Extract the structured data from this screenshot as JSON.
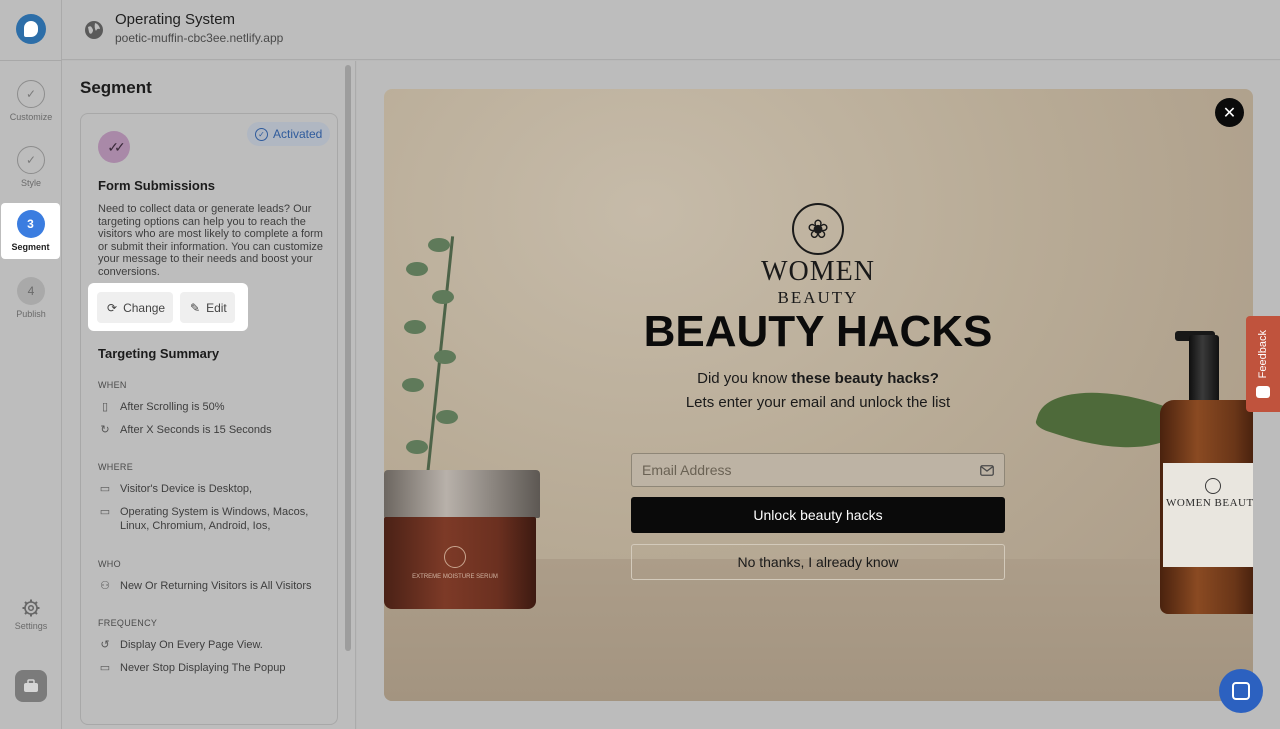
{
  "header": {
    "title": "Operating System",
    "url": "poetic-muffin-cbc3ee.netlify.app"
  },
  "rail": {
    "steps": [
      {
        "label": "Customize",
        "state": "done"
      },
      {
        "label": "Style",
        "state": "done"
      },
      {
        "number": "3",
        "label": "Segment",
        "state": "active"
      },
      {
        "number": "4",
        "label": "Publish",
        "state": "pending"
      }
    ],
    "settings_label": "Settings"
  },
  "panel": {
    "title": "Segment",
    "badge": "Activated",
    "segment_title": "Form Submissions",
    "segment_desc": "Need to collect data or generate leads? Our targeting options can help you to reach the visitors who are most likely to complete a form or submit their information. You can customize your message to their needs and boost your conversions.",
    "change_label": "Change",
    "edit_label": "Edit",
    "summary_title": "Targeting Summary",
    "sections": {
      "when": {
        "label": "WHEN",
        "rules": [
          "After Scrolling is 50%",
          "After X Seconds is 15 Seconds"
        ]
      },
      "where": {
        "label": "WHERE",
        "rules": [
          "Visitor's Device is Desktop,",
          "Operating System is Windows, Macos, Linux, Chromium, Android, Ios,"
        ]
      },
      "who": {
        "label": "WHO",
        "rules": [
          "New Or Returning Visitors is All Visitors"
        ]
      },
      "frequency": {
        "label": "FREQUENCY",
        "rules": [
          "Display On Every Page View.",
          "Never Stop Displaying The Popup"
        ]
      }
    }
  },
  "popup": {
    "brand_name": "WOMEN",
    "brand_sub": "BEAUTY",
    "headline": "BEAUTY HACKS",
    "sub1_prefix": "Did you know ",
    "sub1_bold": "these beauty hacks?",
    "sub2": "Lets enter your email and unlock the list",
    "email_placeholder": "Email Address",
    "unlock_label": "Unlock beauty hacks",
    "no_thanks_label": "No thanks, I already know",
    "jar_label": "EXTREME MOISTURE SERUM",
    "bottle_label": "WOMEN BEAUTY"
  },
  "feedback_label": "Feedback",
  "colors": {
    "accent": "#3b7de0",
    "feedback": "#c0533d",
    "chat": "#2c61c0"
  }
}
